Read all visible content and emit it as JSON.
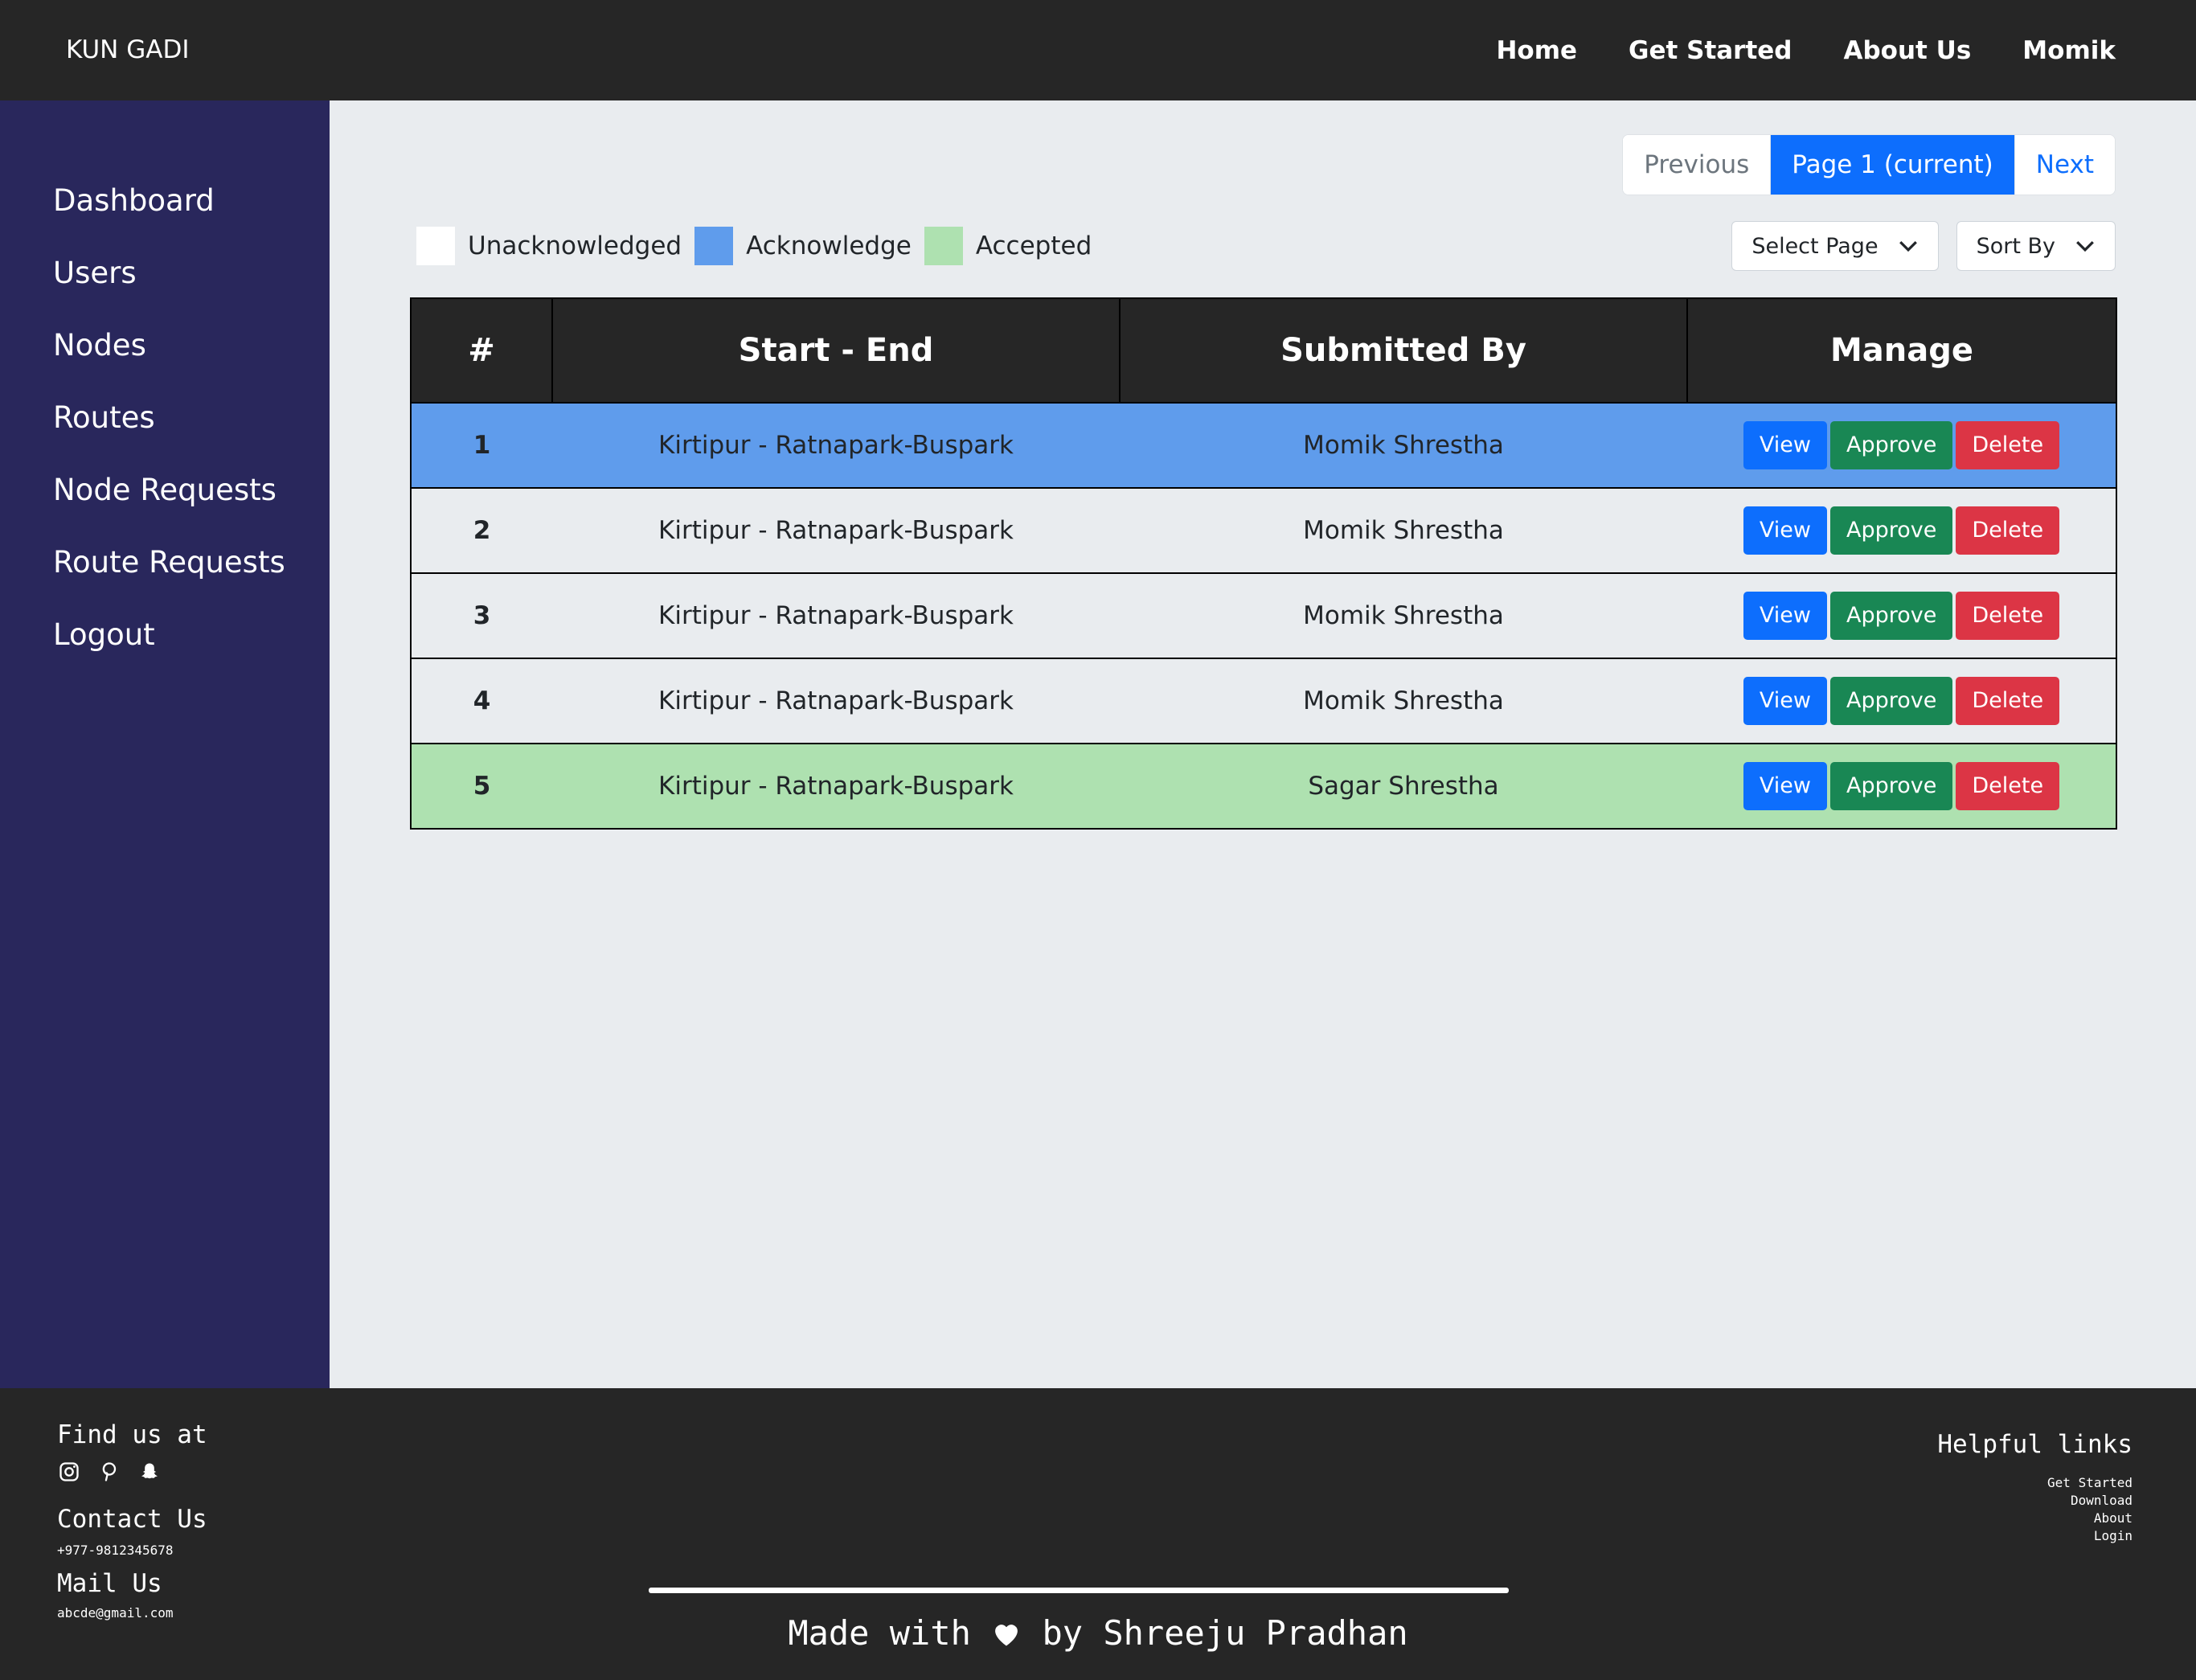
{
  "navbar": {
    "brand": "KUN GADI",
    "links": [
      "Home",
      "Get Started",
      "About Us",
      "Momik"
    ]
  },
  "sidebar": {
    "items": [
      "Dashboard",
      "Users",
      "Nodes",
      "Routes",
      "Node Requests",
      "Route Requests",
      "Logout"
    ]
  },
  "pagination": {
    "previous": "Previous",
    "current": "Page 1 (current)",
    "next": "Next"
  },
  "legend": [
    {
      "label": "Unacknowledged",
      "color": "#ffffff"
    },
    {
      "label": "Acknowledge",
      "color": "#5f9cec"
    },
    {
      "label": "Accepted",
      "color": "#aee1b0"
    }
  ],
  "filters": {
    "select_page": "Select Page",
    "sort_by": "Sort By"
  },
  "table": {
    "headers": [
      "#",
      "Start - End",
      "Submitted By",
      "Manage"
    ],
    "rows": [
      {
        "num": "1",
        "route": "Kirtipur - Ratnapark-Buspark",
        "submitted_by": "Momik Shrestha",
        "status_color": "#5f9cec"
      },
      {
        "num": "2",
        "route": "Kirtipur - Ratnapark-Buspark",
        "submitted_by": "Momik Shrestha",
        "status_color": "#e9ecef"
      },
      {
        "num": "3",
        "route": "Kirtipur - Ratnapark-Buspark",
        "submitted_by": "Momik Shrestha",
        "status_color": "#e9ecef"
      },
      {
        "num": "4",
        "route": "Kirtipur - Ratnapark-Buspark",
        "submitted_by": "Momik Shrestha",
        "status_color": "#e9ecef"
      },
      {
        "num": "5",
        "route": "Kirtipur - Ratnapark-Buspark",
        "submitted_by": "Sagar Shrestha",
        "status_color": "#aee1b0"
      }
    ],
    "actions": {
      "view": "View",
      "approve": "Approve",
      "delete": "Delete"
    }
  },
  "footer": {
    "find_us": "Find us at",
    "social_icons": [
      "instagram-icon",
      "pinterest-icon",
      "snapchat-icon"
    ],
    "contact_title": "Contact Us",
    "phone": "+977-9812345678",
    "mail_title": "Mail Us",
    "email": "abcde@gmail.com",
    "helpful_title": "Helpful links",
    "helpful_links": [
      "Get Started",
      "Download",
      "About",
      "Login"
    ],
    "made_with_prefix": "Made with",
    "made_with_suffix": "by Shreeju Pradhan"
  }
}
